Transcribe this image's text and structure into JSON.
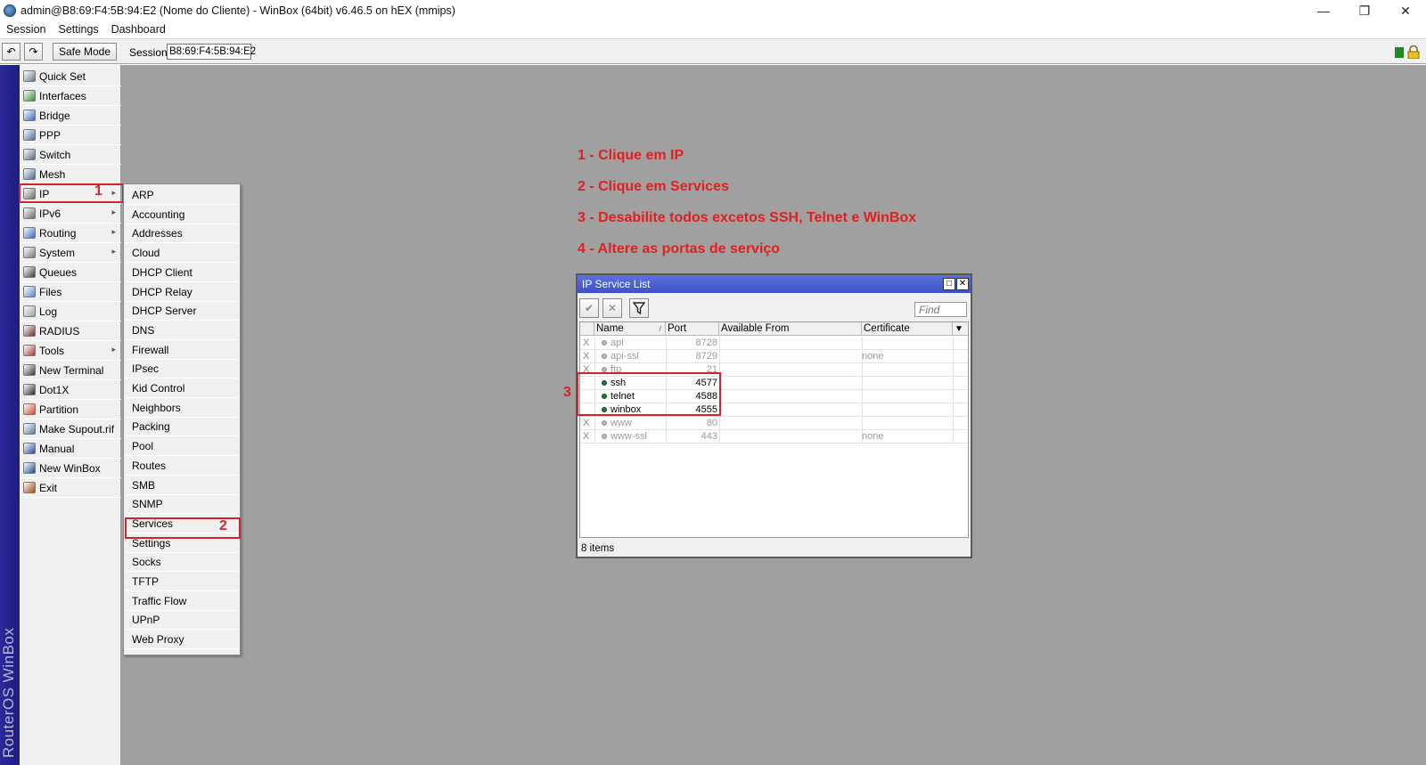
{
  "window": {
    "title": "admin@B8:69:F4:5B:94:E2 (Nome do Cliente) - WinBox (64bit) v6.46.5 on hEX (mmips)",
    "minimize": "—",
    "restore": "❐",
    "close": "✕"
  },
  "menubar": [
    "Session",
    "Settings",
    "Dashboard"
  ],
  "toolbar": {
    "undo": "↶",
    "redo": "↷",
    "safe_mode": "Safe Mode",
    "session_label": "Session:",
    "session_value": "B8:69:F4:5B:94:E2"
  },
  "vertical_brand": "RouterOS WinBox",
  "sidebar": [
    {
      "label": "Quick Set",
      "icon": "quick-set-icon",
      "arrow": false
    },
    {
      "label": "Interfaces",
      "icon": "interfaces-icon",
      "arrow": false
    },
    {
      "label": "Bridge",
      "icon": "bridge-icon",
      "arrow": false
    },
    {
      "label": "PPP",
      "icon": "ppp-icon",
      "arrow": false
    },
    {
      "label": "Switch",
      "icon": "switch-icon",
      "arrow": false
    },
    {
      "label": "Mesh",
      "icon": "mesh-icon",
      "arrow": false
    },
    {
      "label": "IP",
      "icon": "ip-icon",
      "arrow": true
    },
    {
      "label": "IPv6",
      "icon": "ipv6-icon",
      "arrow": true
    },
    {
      "label": "Routing",
      "icon": "routing-icon",
      "arrow": true
    },
    {
      "label": "System",
      "icon": "system-icon",
      "arrow": true
    },
    {
      "label": "Queues",
      "icon": "queues-icon",
      "arrow": false
    },
    {
      "label": "Files",
      "icon": "files-icon",
      "arrow": false
    },
    {
      "label": "Log",
      "icon": "log-icon",
      "arrow": false
    },
    {
      "label": "RADIUS",
      "icon": "radius-icon",
      "arrow": false
    },
    {
      "label": "Tools",
      "icon": "tools-icon",
      "arrow": true
    },
    {
      "label": "New Terminal",
      "icon": "terminal-icon",
      "arrow": false
    },
    {
      "label": "Dot1X",
      "icon": "dot1x-icon",
      "arrow": false
    },
    {
      "label": "Partition",
      "icon": "partition-icon",
      "arrow": false
    },
    {
      "label": "Make Supout.rif",
      "icon": "supout-icon",
      "arrow": false
    },
    {
      "label": "Manual",
      "icon": "manual-icon",
      "arrow": false
    },
    {
      "label": "New WinBox",
      "icon": "winbox-icon",
      "arrow": false
    },
    {
      "label": "Exit",
      "icon": "exit-icon",
      "arrow": false
    }
  ],
  "submenu": [
    "ARP",
    "Accounting",
    "Addresses",
    "Cloud",
    "DHCP Client",
    "DHCP Relay",
    "DHCP Server",
    "DNS",
    "Firewall",
    "IPsec",
    "Kid Control",
    "Neighbors",
    "Packing",
    "Pool",
    "Routes",
    "SMB",
    "SNMP",
    "Services",
    "Settings",
    "Socks",
    "TFTP",
    "Traffic Flow",
    "UPnP",
    "Web Proxy"
  ],
  "annotations": {
    "step1": "1",
    "step2": "2",
    "step3": "3"
  },
  "instructions": [
    "1 - Clique em IP",
    "2 - Clique em Services",
    "3 - Desabilite todos excetos SSH, Telnet e WinBox",
    "4 - Altere as portas de serviço"
  ],
  "service_window": {
    "title": "IP Service List",
    "find_placeholder": "Find",
    "enable_icon": "✔",
    "disable_icon": "✕",
    "filter_icon": "filter-icon",
    "columns": [
      "Name",
      "Port",
      "Available From",
      "Certificate"
    ],
    "sort_marker": "/",
    "dropdown": "▼",
    "rows": [
      {
        "flag": "X",
        "name": "api",
        "port": "8728",
        "cert": "",
        "enabled": false
      },
      {
        "flag": "X",
        "name": "api-ssl",
        "port": "8729",
        "cert": "none",
        "enabled": false
      },
      {
        "flag": "X",
        "name": "ftp",
        "port": "21",
        "cert": "",
        "enabled": false
      },
      {
        "flag": "",
        "name": "ssh",
        "port": "4577",
        "cert": "",
        "enabled": true
      },
      {
        "flag": "",
        "name": "telnet",
        "port": "4588",
        "cert": "",
        "enabled": true
      },
      {
        "flag": "",
        "name": "winbox",
        "port": "4555",
        "cert": "",
        "enabled": true
      },
      {
        "flag": "X",
        "name": "www",
        "port": "80",
        "cert": "",
        "enabled": false
      },
      {
        "flag": "X",
        "name": "www-ssl",
        "port": "443",
        "cert": "none",
        "enabled": false
      }
    ],
    "status": "8 items"
  },
  "colors": {
    "accent_red": "#d2232a",
    "title_blue": "#4a5fd0",
    "sidebar_bar": "#1c1c80",
    "enabled_dot": "#1f7a3a"
  }
}
